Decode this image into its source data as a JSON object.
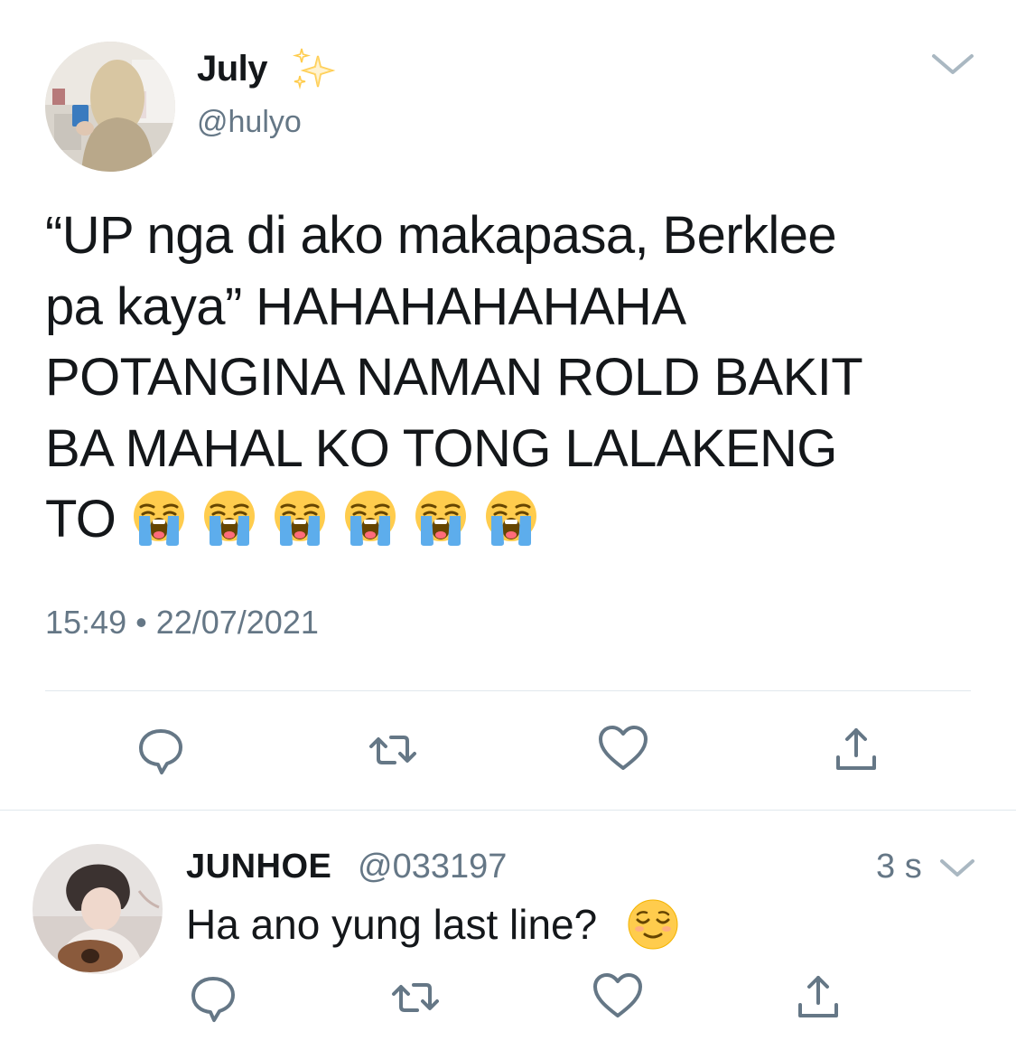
{
  "main_tweet": {
    "display_name": "July",
    "handle": "@hulyo",
    "text_lines": [
      "“UP nga di ako makapasa, Berklee",
      "pa kaya” HAHAHAHAHAHA",
      "POTANGINA NAMAN ROLD BAKIT",
      "BA MAHAL KO TONG LALAKENG",
      "TO"
    ],
    "emoji_count_visible": 6,
    "emoji_name": "loudly-crying-face",
    "timestamp": "15:49 • 22/07/2021",
    "actions": [
      "reply-icon",
      "retweet-icon",
      "like-icon",
      "share-icon"
    ]
  },
  "reply": {
    "display_name": "JUNHOE",
    "handle": "@033197",
    "time": "3 s",
    "text": "Ha ano yung last line?",
    "emoji_name": "relieved-face",
    "actions": [
      "reply-icon",
      "retweet-icon",
      "like-icon",
      "share-icon"
    ]
  },
  "colors": {
    "text": "#14171a",
    "secondary": "#657786",
    "icon": "#657786",
    "divider": "#e1e8ed",
    "sparkle": "#ffcc4d",
    "emoji_face": "#ffcc4d",
    "tear": "#5dadec"
  }
}
